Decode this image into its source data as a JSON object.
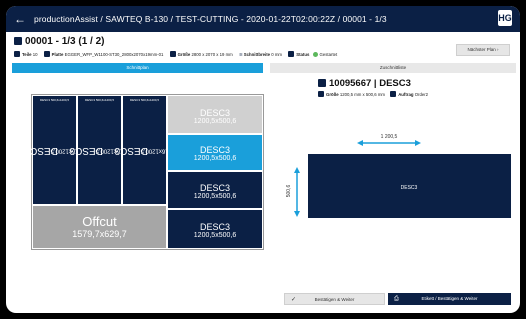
{
  "topbar": {
    "back_icon": "arrow-left-icon",
    "breadcrumb": "productionAssist  /  SAWTEQ B-130  /  TEST-CUTTING - 2020-01-22T02:00:22Z  /  00001 - 1/3",
    "logo": "HG"
  },
  "header": {
    "title": "00001 - 1/3 (1 / 2)",
    "teile_label": "Teile",
    "teile_value": "10",
    "platte_label": "Platte",
    "platte_value": "EGGER_WFP_W1100-ST30_2800x2070x19mm-01",
    "groesse_label": "Größe",
    "groesse_value": "2800 x 2070 x 19 mm",
    "schnittbreite_label": "Schnittbreite",
    "schnittbreite_value": "0 mm",
    "status_label": "Status",
    "status_value": "Gestartet",
    "next_button": "Nächster Plan"
  },
  "tabs": {
    "plan": "Schnittplan",
    "detail": "Zuschnittliste"
  },
  "plan": {
    "pieces": [
      {
        "name": "DESC3",
        "dims": "500,6x1200,5",
        "small": "DESC3 500,6x1200,5"
      },
      {
        "name": "DESC3",
        "dims": "500,6x1200,5",
        "small": "DESC3 500,6x1200,5"
      },
      {
        "name": "DESC3",
        "dims": "500,6x1200,5",
        "small": "DESC3 500,6x1200,5"
      }
    ],
    "right_pieces": [
      {
        "name": "DESC3",
        "dims": "1200,5x500,6"
      },
      {
        "name": "DESC3",
        "dims": "1200,5x500,6"
      },
      {
        "name": "DESC3",
        "dims": "1200,5x500,6"
      },
      {
        "name": "DESC3",
        "dims": "1200,5x500,6"
      }
    ],
    "offcut_label": "Offcut",
    "offcut_dims": "1579,7x629,7"
  },
  "detail": {
    "title": "10095667 | DESC3",
    "groesse_label": "Größe",
    "groesse_value": "1200,5 mm x 500,6 mm",
    "auftrag_label": "Auftrag",
    "auftrag_value": "Order2",
    "width_dim": "1 200,5",
    "height_dim": "500,6",
    "part_label": "DESC3"
  },
  "actions": {
    "confirm": "Bestätigen & Weiter",
    "print": "Etikett / Bestätigen & Weiter"
  },
  "colors": {
    "navy": "#0b2045",
    "accent": "#1a9fda",
    "status_green": "#5cb85c"
  }
}
